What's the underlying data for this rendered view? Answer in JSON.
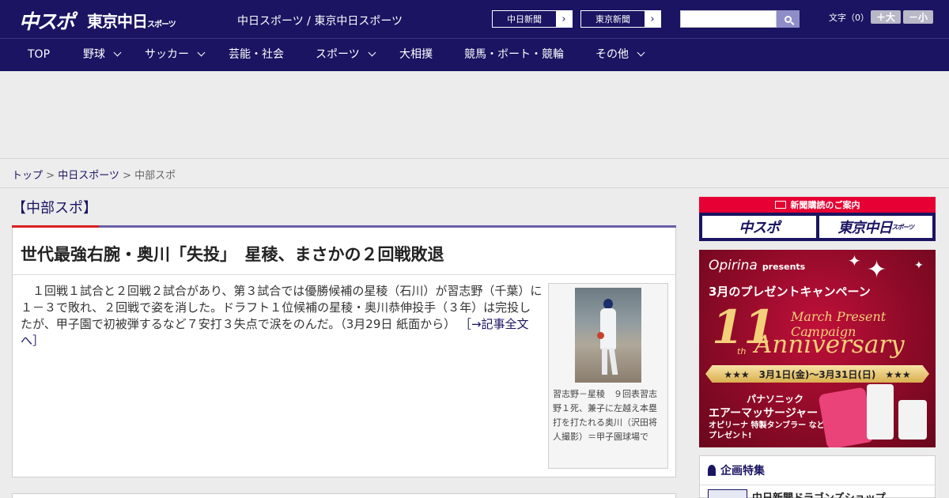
{
  "header": {
    "logo_primary": "中スポ",
    "logo_secondary": "東京中日",
    "logo_secondary_small": "スポーツ",
    "site_title": "中日スポーツ / 東京中日スポーツ",
    "btn_chunichi": "中日新聞",
    "btn_tokyo": "東京新聞",
    "btn_arrow": "›",
    "search_placeholder": "",
    "font_label": "文字（0）",
    "font_larger": "＋大",
    "font_smaller": "－小"
  },
  "nav": {
    "items": [
      {
        "label": "TOP"
      },
      {
        "label": "野球"
      },
      {
        "label": "サッカー"
      },
      {
        "label": "芸能・社会"
      },
      {
        "label": "スポーツ"
      },
      {
        "label": "大相撲"
      },
      {
        "label": "競馬・ボート・競輪"
      },
      {
        "label": "その他"
      }
    ]
  },
  "breadcrumb": {
    "top": "トップ",
    "sep1": " > ",
    "chunichi": "中日スポーツ",
    "sep2": " > ",
    "current": "中部スポ"
  },
  "section": {
    "label": "【中部スポ】"
  },
  "article": {
    "title": "世代最強右腕・奥川「失投」　星稜、まさかの２回戦敗退",
    "body": "　１回戦１試合と２回戦２試合があり、第３試合では優勝候補の星稜（石川）が習志野（千葉）に１－３で敗れ、２回戦で姿を消した。ドラフト１位候補の星稜・奥川恭伸投手（３年）は完投したが、甲子園で初被弾するなど７安打３失点で涙をのんだ。（3月29日 紙面から）",
    "more_link": "［→記事全文へ］",
    "photo_caption": "習志野－星稜　９回表習志野１死、兼子に左越え本塁打を打たれる奥川（沢田将人撮影）＝甲子園球場で"
  },
  "sidebar": {
    "subscribe_label": "新聞購読のご案内",
    "subscribe_logo1": "中スポ",
    "subscribe_logo2": "東京中日",
    "subscribe_logo2_small": "スポーツ",
    "promo": {
      "brand": "Opirina",
      "brand_suffix": "presents",
      "campaign": "3月のプレゼントキャンペーン",
      "number": "11",
      "march_text": "March Present Campaign",
      "th": "th",
      "anniversary": "Anniversary",
      "dates": "★★★　3月1日(金)～3月31日(日)　★★★",
      "prize_line1": "パナソニック",
      "prize_line2": "エアーマッサージャー",
      "prize_line3": "オピリーナ 特製タンブラー など プレゼント!"
    },
    "feature_title": "企画特集",
    "feature_item": "中日新聞ドラゴンズショップ"
  }
}
